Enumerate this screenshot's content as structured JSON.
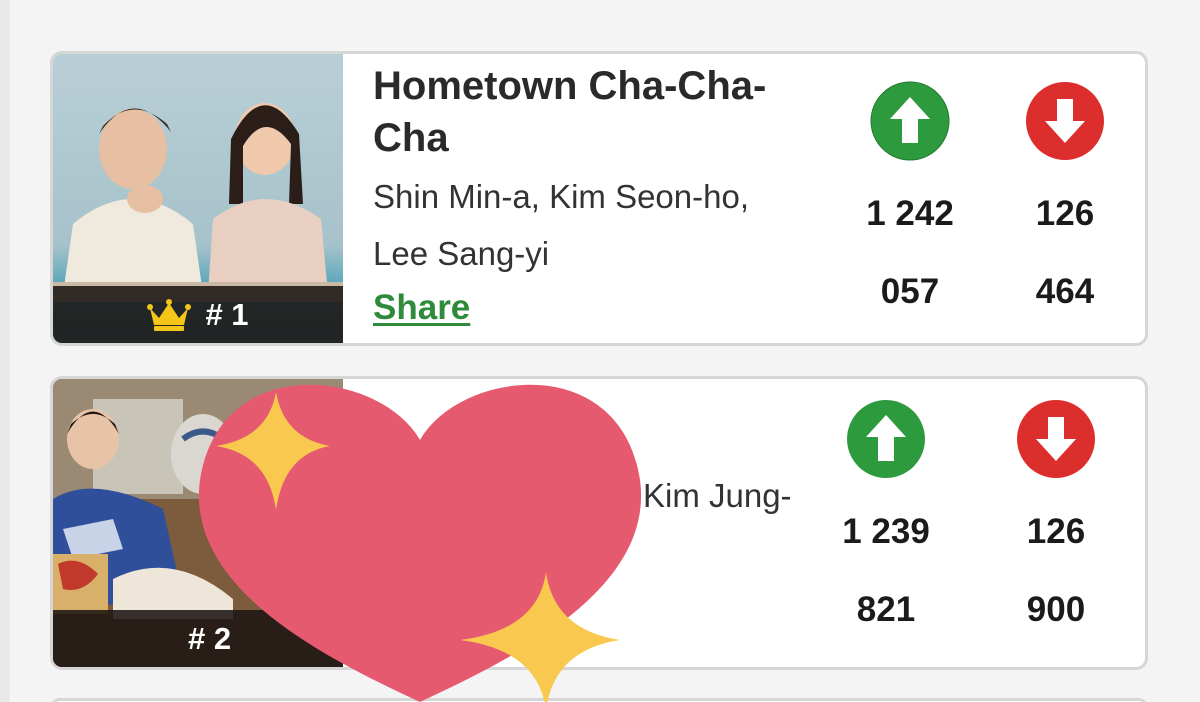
{
  "items": [
    {
      "rank_label": "# 1",
      "title": "Hometown Cha-Cha-Cha",
      "cast": "Shin Min-a, Kim Seon-ho, Lee Sang-yi",
      "share_label": "Share",
      "upvotes": "1 242 057",
      "downvotes": "126 464"
    },
    {
      "rank_label": "# 2",
      "cast_partial": "Kim Jung-",
      "upvotes": "1 239 821",
      "downvotes": "126 900"
    }
  ],
  "icons": {
    "crown": "crown-icon",
    "upvote": "arrow-up-icon",
    "downvote": "arrow-down-icon",
    "sticker": "sparkling-heart-icon"
  },
  "colors": {
    "upvote_green": "#2e9a3e",
    "downvote_red": "#dd2e2e",
    "share_green": "#2e8b3c",
    "heart_pink": "#e65a6f",
    "sparkle_yellow": "#f8c84f",
    "crown_gold": "#f5c518"
  }
}
